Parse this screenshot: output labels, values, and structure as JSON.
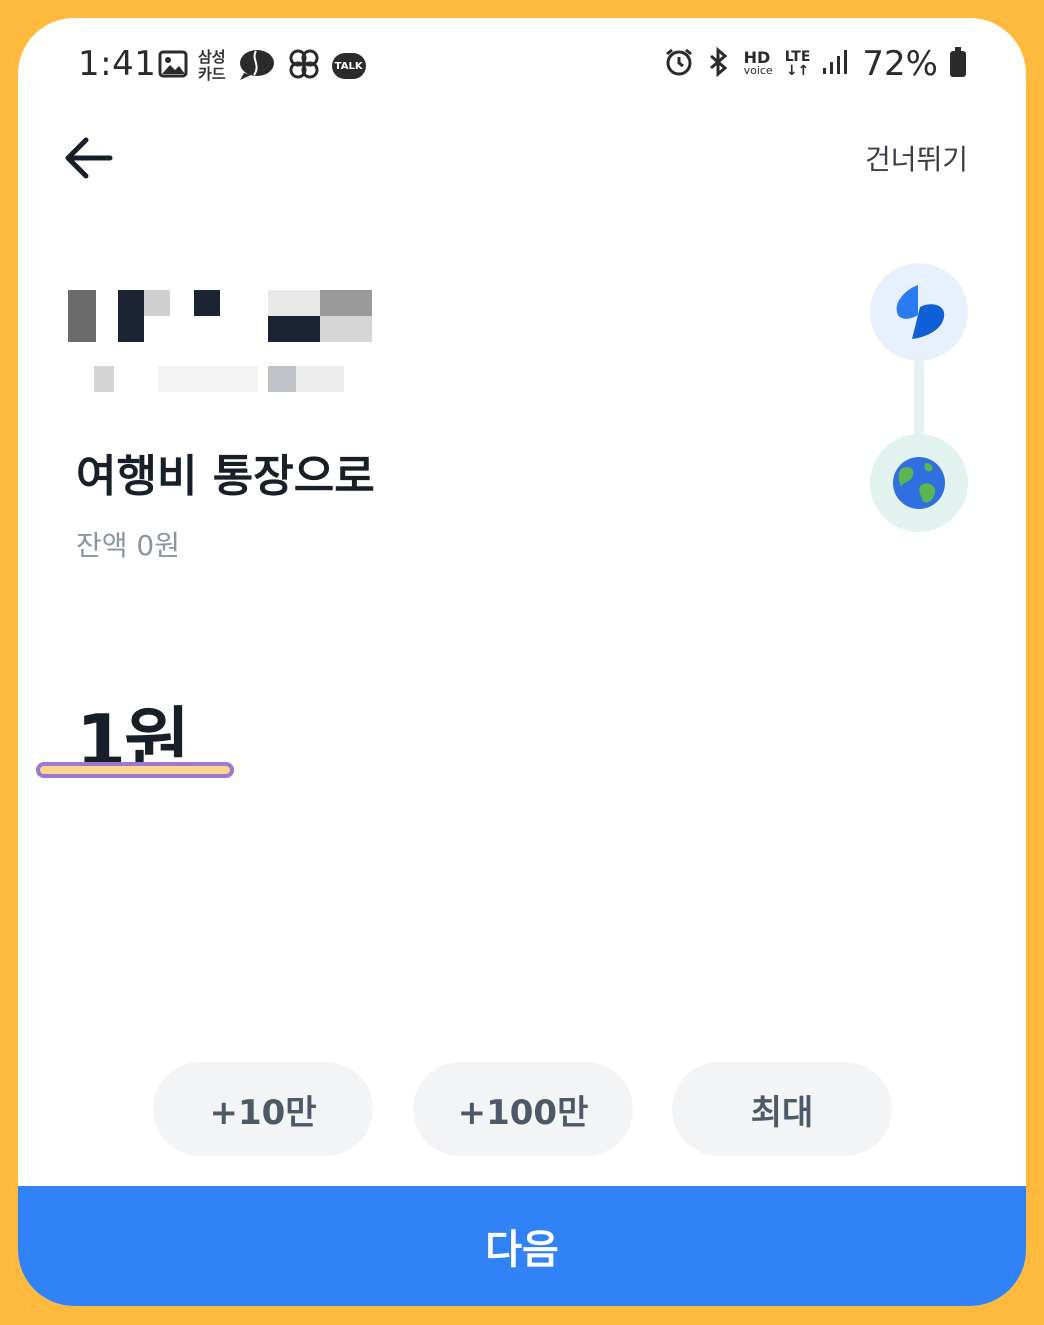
{
  "status_bar": {
    "time": "1:41",
    "card_line1": "삼성",
    "card_line2": "카드",
    "talk_label": "TALK",
    "hd_label": "HD",
    "hd_sub": "voice",
    "lte_label": "LTE",
    "battery_percent": "72%",
    "icons": [
      "gallery-icon",
      "samsung-card-icon",
      "chat-bubble-icon",
      "pinwheel-icon",
      "kakaotalk-icon",
      "alarm-icon",
      "bluetooth-icon",
      "hd-voice-icon",
      "lte-icon",
      "signal-icon",
      "battery-icon"
    ]
  },
  "header": {
    "back_icon": "back-arrow-icon",
    "skip_label": "건너뛰기"
  },
  "account": {
    "target_title": "여행비 통장으로",
    "balance_text": "잔액 0원",
    "from_icon": "toss-logo-icon",
    "to_icon": "globe-icon"
  },
  "amount": {
    "value": "1원"
  },
  "quick_buttons": [
    {
      "label": "+10만"
    },
    {
      "label": "+100만"
    },
    {
      "label": "최대"
    }
  ],
  "footer": {
    "next_label": "다음"
  },
  "colors": {
    "accent": "#3182f6",
    "frame": "#ffb93c"
  }
}
